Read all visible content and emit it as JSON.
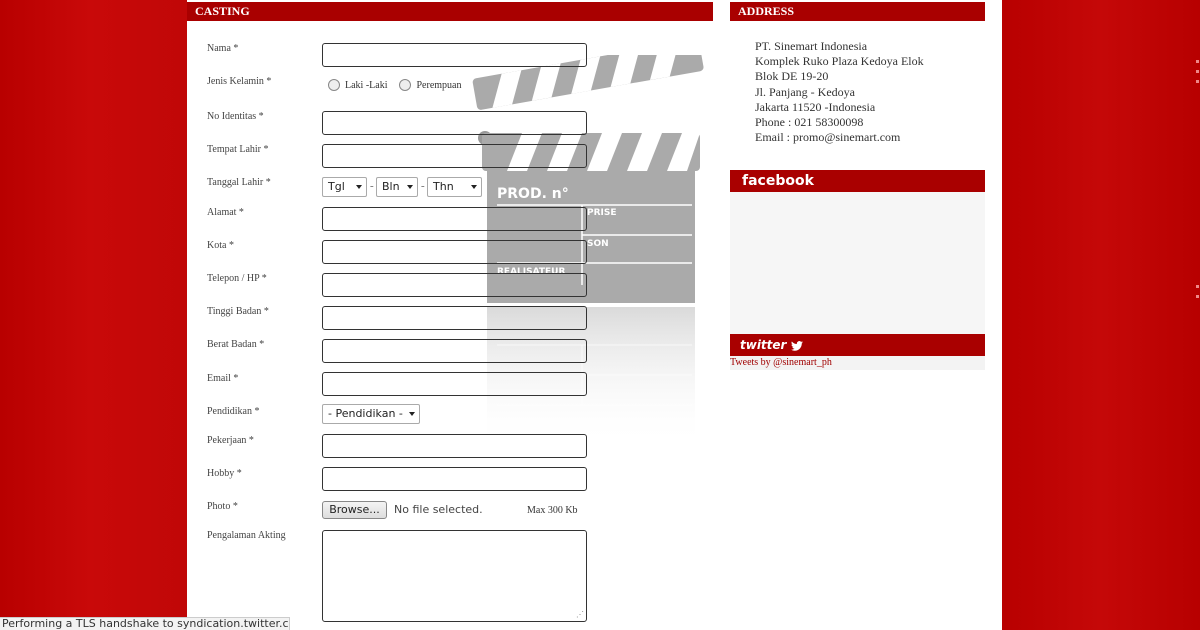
{
  "sections": {
    "casting": "CASTING",
    "address": "ADDRESS",
    "facebook": "facebook",
    "twitter": "twitter"
  },
  "address_lines": [
    "PT. Sinemart Indonesia",
    "Komplek Ruko Plaza Kedoya Elok",
    "Blok DE 19-20",
    "Jl. Panjang - Kedoya",
    "Jakarta 11520 -Indonesia",
    "Phone : 021 58300098",
    "Email : promo@sinemart.com"
  ],
  "twitter_link": "Tweets by @sinemart_ph",
  "form": {
    "labels": {
      "nama": "Nama *",
      "jenis_kelamin": "Jenis Kelamin *",
      "no_identitas": "No Identitas *",
      "tempat_lahir": "Tempat Lahir *",
      "tanggal_lahir": "Tanggal Lahir *",
      "alamat": "Alamat *",
      "kota": "Kota *",
      "telepon": "Telepon / HP *",
      "tinggi_badan": "Tinggi Badan *",
      "berat_badan": "Berat Badan *",
      "email": "Email *",
      "pendidikan": "Pendidikan *",
      "pekerjaan": "Pekerjaan *",
      "hobby": "Hobby *",
      "photo": "Photo *",
      "pengalaman": "Pengalaman Akting"
    },
    "gender_options": [
      "Laki -Laki",
      "Perempuan"
    ],
    "date_selects": {
      "day": "Tgl",
      "month": "Bln",
      "year": "Thn",
      "separator": "-"
    },
    "pendidikan_select": "- Pendidikan -",
    "browse_label": "Browse...",
    "no_file": "No file selected.",
    "max_size": "Max 300 Kb"
  },
  "clapper_text": {
    "prod": "PROD. n°",
    "prise": "PRISE",
    "son": "SON",
    "realisateur": "REALISATEUR"
  },
  "status_bar": "Performing a TLS handshake to syndication.twitter.com..."
}
